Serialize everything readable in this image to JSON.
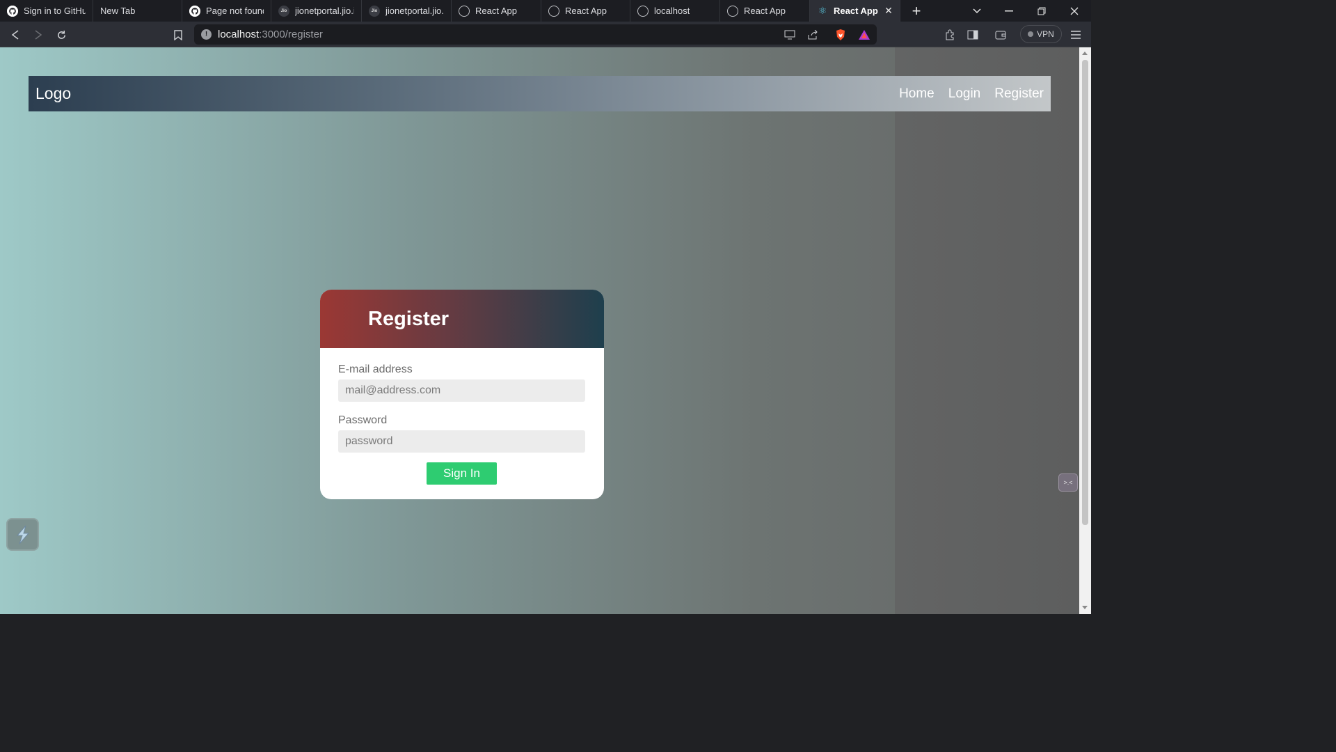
{
  "browser": {
    "tabs": [
      {
        "title": "Sign in to GitHub",
        "icon": "github-icon",
        "active": false
      },
      {
        "title": "New Tab",
        "icon": "",
        "active": false
      },
      {
        "title": "Page not found · GitHub",
        "icon": "github-icon",
        "active": false
      },
      {
        "title": "jionetportal.jio.in",
        "icon": "jio-icon",
        "active": false
      },
      {
        "title": "jionetportal.jio.in",
        "icon": "jio-icon",
        "active": false
      },
      {
        "title": "React App",
        "icon": "globe-icon",
        "active": false
      },
      {
        "title": "React App",
        "icon": "globe-icon",
        "active": false
      },
      {
        "title": "localhost",
        "icon": "globe-icon",
        "active": false
      },
      {
        "title": "React App",
        "icon": "globe-icon",
        "active": false
      },
      {
        "title": "React App",
        "icon": "react-icon",
        "active": true
      }
    ],
    "address": {
      "host": "localhost",
      "path": ":3000/register"
    },
    "vpn_label": "VPN"
  },
  "page": {
    "navbar": {
      "logo": "Logo",
      "links": [
        "Home",
        "Login",
        "Register"
      ]
    },
    "card": {
      "title": "Register",
      "email_label": "E-mail address",
      "email_placeholder": "mail@address.com",
      "password_label": "Password",
      "password_placeholder": "password",
      "submit_label": "Sign In"
    }
  },
  "colors": {
    "accent_button": "#2ecc71",
    "card_header_start": "#9b3834",
    "card_header_end": "#1e3f4d",
    "navbar_start": "#2c3e50"
  }
}
